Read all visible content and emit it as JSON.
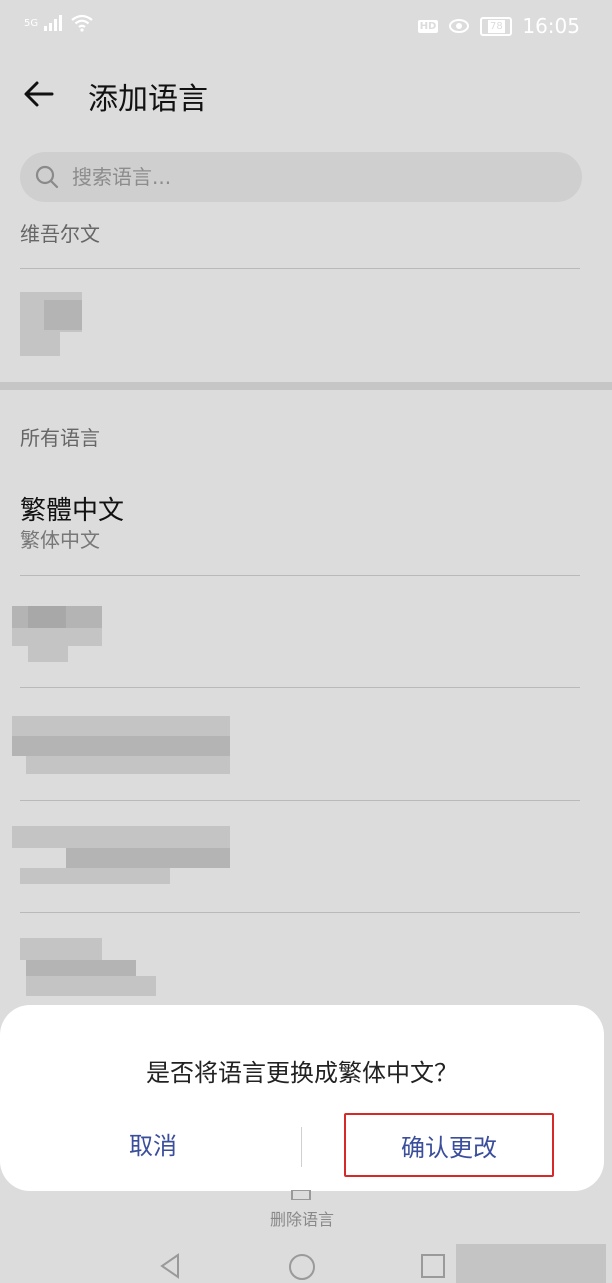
{
  "status_bar": {
    "network": "5G",
    "hd": "HD",
    "battery": "78",
    "time": "16:05"
  },
  "header": {
    "title": "添加语言"
  },
  "search": {
    "placeholder": "搜索语言..."
  },
  "list": {
    "top_item": "维吾尔文",
    "section_header": "所有语言",
    "item_main": "繁體中文",
    "item_sub": "繁体中文"
  },
  "dialog": {
    "message": "是否将语言更换成繁体中文？",
    "cancel_label": "取消",
    "confirm_label": "确认更改"
  },
  "bottom": {
    "delete_label": "删除语言"
  },
  "colors": {
    "dialog_button": "#3a4e9b",
    "highlight_border": "#d42a2a",
    "dimmed_background": "#dcdcdc"
  }
}
